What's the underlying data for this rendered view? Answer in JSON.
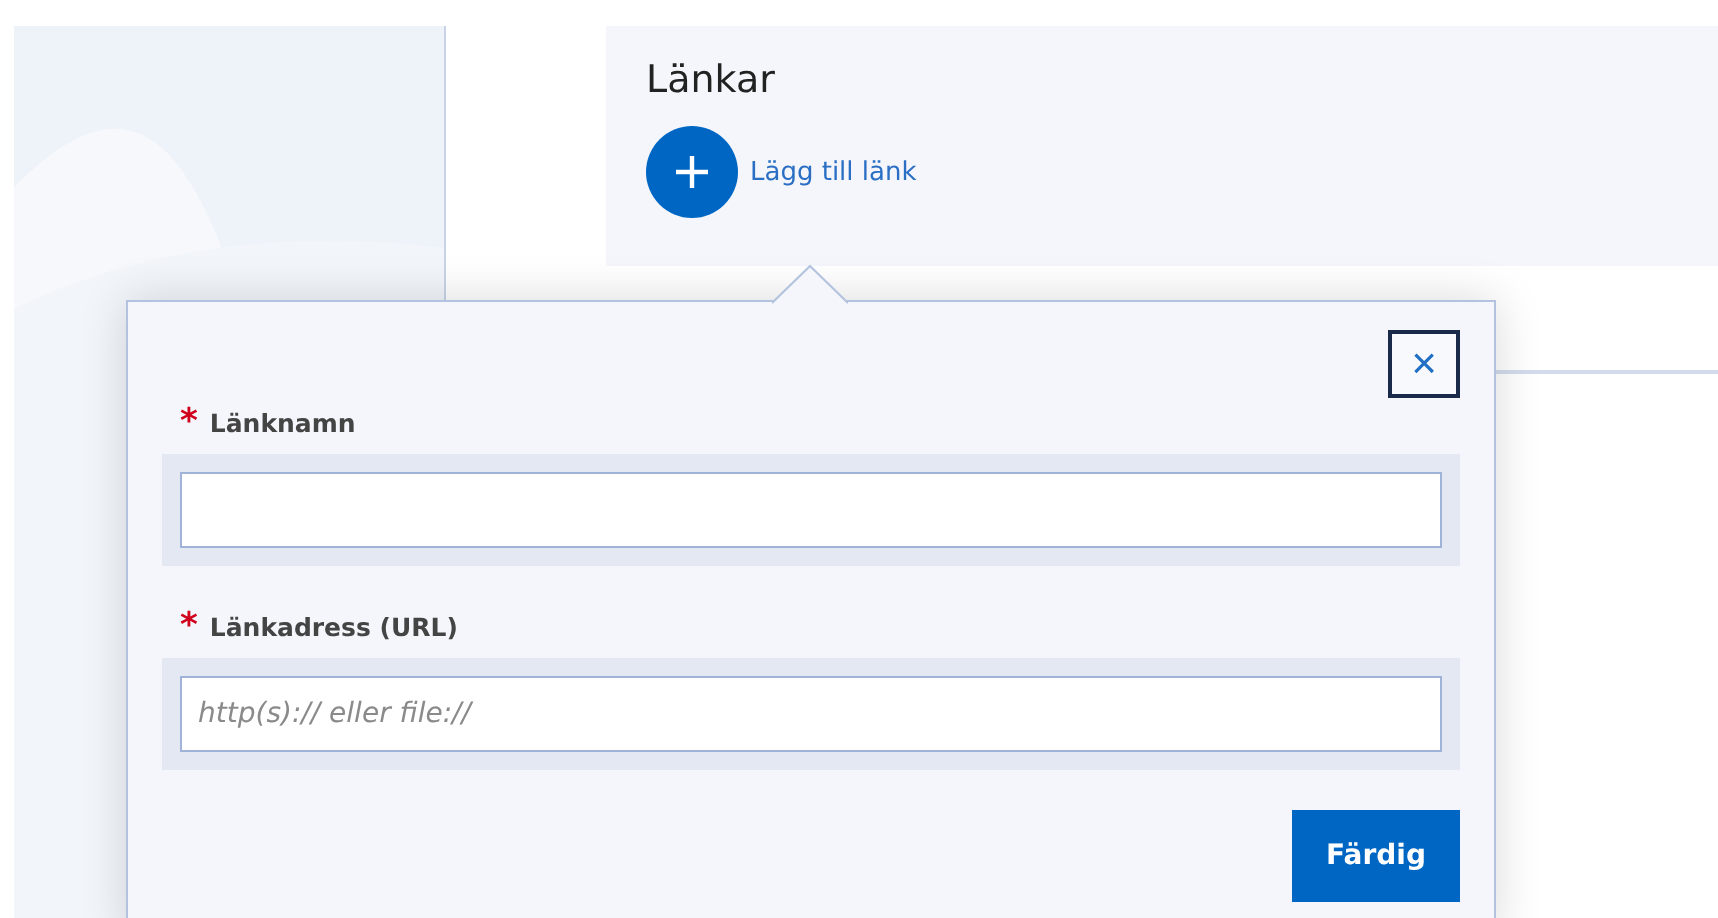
{
  "links_card": {
    "title": "Länkar",
    "add_link": {
      "label": "Lägg till länk"
    }
  },
  "popover": {
    "fields": [
      {
        "label": "Länknamn",
        "required_mark": "*"
      },
      {
        "label": "Länkadress (URL)",
        "required_mark": "*",
        "placeholder": "http(s):// eller file://"
      }
    ],
    "close": {
      "label": "×"
    },
    "done_button": {
      "label": "Färdig"
    }
  }
}
